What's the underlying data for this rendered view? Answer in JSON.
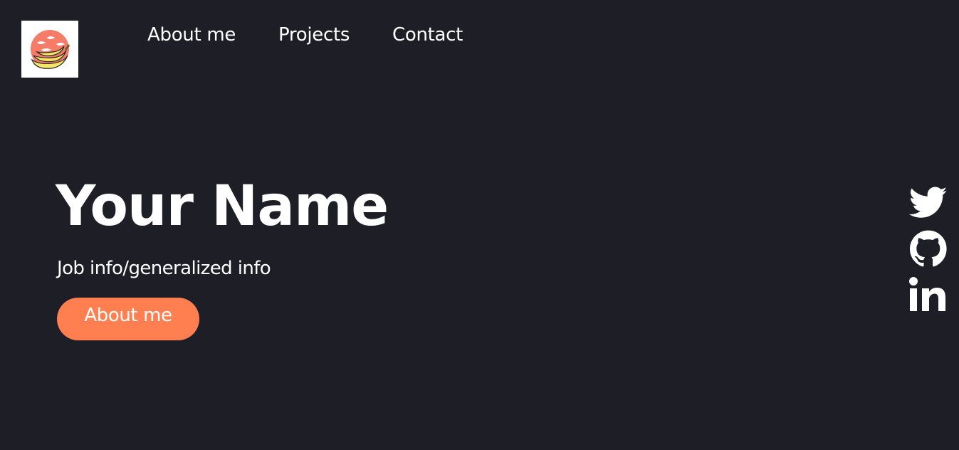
{
  "header": {
    "logo_alt": "bananas logo",
    "nav": [
      {
        "label": "About me"
      },
      {
        "label": "Projects"
      },
      {
        "label": "Contact"
      }
    ]
  },
  "hero": {
    "name": "Your Name",
    "subtitle": "Job info/generalized info",
    "cta_label": "About me"
  },
  "social": {
    "icons": [
      "twitter-icon",
      "github-icon",
      "linkedin-icon"
    ]
  },
  "colors": {
    "background": "#1e1e26",
    "accent": "#ff7f50",
    "text": "#ffffff",
    "logo_sun": "#f47c68",
    "logo_banana": "#f7e463"
  }
}
